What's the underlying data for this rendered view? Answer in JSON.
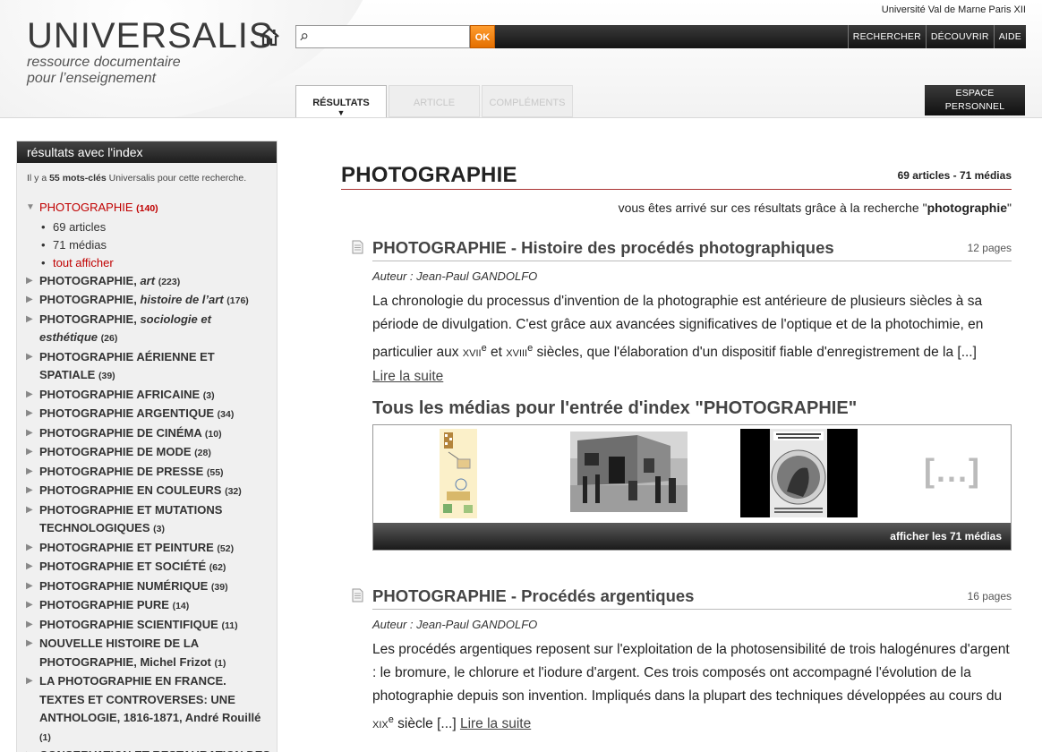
{
  "header": {
    "university": "Université Val de Marne Paris XII",
    "logo_title": "UNIVERSALIS",
    "logo_sub_1": "ressource documentaire",
    "logo_sub_2": "pour l’enseignement",
    "search_placeholder": "",
    "search_ok": "OK",
    "nav": [
      "RECHERCHER",
      "DÉCOUVRIR",
      "AIDE"
    ],
    "tabs": {
      "resultats": "RÉSULTATS",
      "article": "ARTICLE",
      "complements": "COMPLÉMENTS"
    },
    "espace_1": "ESPACE",
    "espace_2": "PERSONNEL"
  },
  "sidebar": {
    "title": "résultats avec l'index",
    "intro_pre": "Il y a ",
    "intro_bold": "55 mots-clés",
    "intro_post": " Universalis pour cette recherche.",
    "active": {
      "label": "PHOTOGRAPHIE",
      "count": "(140)"
    },
    "subitems": [
      "69 articles",
      "71 médias",
      "tout afficher"
    ],
    "items": [
      {
        "label": "PHOTOGRAPHIE, ",
        "italic": "art",
        "count": "(223)"
      },
      {
        "label": "PHOTOGRAPHIE, ",
        "italic": "histoire de l’art",
        "count": "(176)"
      },
      {
        "label": "PHOTOGRAPHIE, ",
        "italic": "sociologie et esthétique",
        "count": "(26)"
      },
      {
        "label": "PHOTOGRAPHIE AÉRIENNE ET SPATIALE",
        "italic": "",
        "count": "(39)"
      },
      {
        "label": "PHOTOGRAPHIE AFRICAINE",
        "italic": "",
        "count": "(3)"
      },
      {
        "label": "PHOTOGRAPHIE ARGENTIQUE",
        "italic": "",
        "count": "(34)"
      },
      {
        "label": "PHOTOGRAPHIE DE CINÉMA",
        "italic": "",
        "count": "(10)"
      },
      {
        "label": "PHOTOGRAPHIE DE MODE",
        "italic": "",
        "count": "(28)"
      },
      {
        "label": "PHOTOGRAPHIE DE PRESSE",
        "italic": "",
        "count": "(55)"
      },
      {
        "label": "PHOTOGRAPHIE EN COULEURS",
        "italic": "",
        "count": "(32)"
      },
      {
        "label": "PHOTOGRAPHIE ET MUTATIONS TECHNOLOGIQUES",
        "italic": "",
        "count": "(3)"
      },
      {
        "label": "PHOTOGRAPHIE ET PEINTURE",
        "italic": "",
        "count": "(52)"
      },
      {
        "label": "PHOTOGRAPHIE ET SOCIÉTÉ",
        "italic": "",
        "count": "(62)"
      },
      {
        "label": "PHOTOGRAPHIE NUMÉRIQUE",
        "italic": "",
        "count": "(39)"
      },
      {
        "label": "PHOTOGRAPHIE PURE",
        "italic": "",
        "count": "(14)"
      },
      {
        "label": "PHOTOGRAPHIE SCIENTIFIQUE",
        "italic": "",
        "count": "(11)"
      },
      {
        "label": "NOUVELLE HISTOIRE DE LA PHOTOGRAPHIE, Michel Frizot",
        "italic": "",
        "count": "(1)"
      },
      {
        "label": "LA PHOTOGRAPHIE EN FRANCE. TEXTES ET CONTROVERSES: UNE ANTHOLOGIE, 1816-1871, André Rouillé",
        "italic": "",
        "count": "(1)"
      },
      {
        "label": "CONSERVATION ET RESTAURATION DES",
        "italic": "",
        "count": ""
      }
    ]
  },
  "main": {
    "title": "PHOTOGRAPHIE",
    "counts": "69 articles - 71 médias",
    "via_pre": "vous êtes arrivé sur ces résultats grâce à la recherche \"",
    "via_term": "photographie",
    "via_post": "\"",
    "article1": {
      "title": "PHOTOGRAPHIE - Histoire des procédés photographiques",
      "pages": "12 pages",
      "author": "Auteur : Jean-Paul GANDOLFO",
      "body_1": "La chronologie du processus d'invention de la photographie est antérieure de plusieurs siècles à sa période de divulgation. C'est grâce aux avancées significatives de l'optique et de la photochimie, en particulier aux ",
      "c1": "XVII",
      "e1": "e",
      "body_2": " et ",
      "c2": "XVIII",
      "e2": "e",
      "body_3": " siècles, que l'élaboration d'un dispositif fiable d'enregistrement de la [...]",
      "more": "Lire la suite"
    },
    "media": {
      "title": "Tous les médias pour l'entrée d'index \"PHOTOGRAPHIE\"",
      "ellipsis": "[...]",
      "bar": "afficher les 71 médias"
    },
    "article2": {
      "title": "PHOTOGRAPHIE - Procédés argentiques",
      "pages": "16 pages",
      "author": "Auteur : Jean-Paul GANDOLFO",
      "body_1": "Les procédés argentiques reposent sur l'exploitation de la photosensibilité de trois halogénures d'argent : le bromure, le chlorure et l'iodure d'argent. Ces trois composés ont accompagné l'évolution de la photographie depuis son invention. Impliqués dans la plupart des techniques développées au cours du ",
      "c1": "XIX",
      "e1": "e",
      "body_2": " siècle [...] ",
      "more": "Lire la suite"
    }
  }
}
